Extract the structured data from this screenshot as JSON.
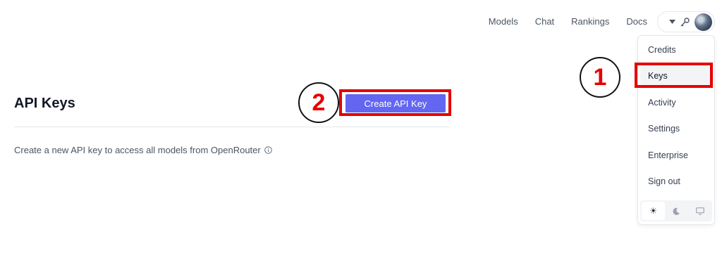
{
  "nav": {
    "links": [
      "Models",
      "Chat",
      "Rankings",
      "Docs"
    ],
    "account_icons": [
      "chevron-down-icon",
      "key-icon",
      "avatar"
    ]
  },
  "menu": {
    "items": [
      "Credits",
      "Keys",
      "Activity",
      "Settings",
      "Enterprise",
      "Sign out"
    ],
    "active_item": "Keys",
    "theme_options": [
      "sun-icon",
      "moon-icon",
      "monitor-icon"
    ],
    "theme_selected": "sun-icon"
  },
  "annotations": {
    "step1": "1",
    "step2": "2",
    "highlight_color": "#e60000"
  },
  "main": {
    "title": "API Keys",
    "create_button_label": "Create API Key",
    "create_button_color": "#6366f1",
    "description": "Create a new API key to access all models from OpenRouter"
  }
}
